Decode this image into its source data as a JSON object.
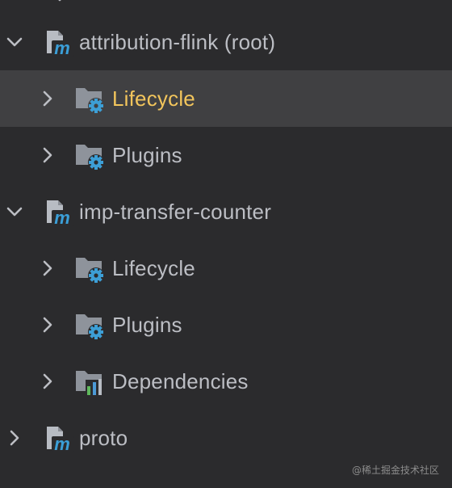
{
  "tree": {
    "items": [
      {
        "label": "attribution-flink (root)",
        "kind": "maven-module",
        "expanded": true,
        "selected": false
      },
      {
        "label": "Lifecycle",
        "kind": "folder-gear",
        "expanded": false,
        "selected": true
      },
      {
        "label": "Plugins",
        "kind": "folder-gear",
        "expanded": false,
        "selected": false
      },
      {
        "label": "imp-transfer-counter",
        "kind": "maven-module",
        "expanded": true,
        "selected": false
      },
      {
        "label": "Lifecycle",
        "kind": "folder-gear",
        "expanded": false,
        "selected": false
      },
      {
        "label": "Plugins",
        "kind": "folder-gear",
        "expanded": false,
        "selected": false
      },
      {
        "label": "Dependencies",
        "kind": "dependencies-chart",
        "expanded": false,
        "selected": false
      },
      {
        "label": "proto",
        "kind": "maven-module",
        "expanded": false,
        "selected": false
      }
    ]
  },
  "watermark": "@稀土掘金技术社区",
  "colors": {
    "background": "#2b2b2d",
    "selected_row": "#404042",
    "text": "#bcbec4",
    "selected_text": "#f2c55c",
    "module_icon": "#b8bcc3",
    "maven_m": "#3b9fd8",
    "folder": "#8e939b",
    "gear": "#3d9fd6",
    "bar_green": "#5fb85c",
    "bar_blue": "#4c9ad6"
  }
}
